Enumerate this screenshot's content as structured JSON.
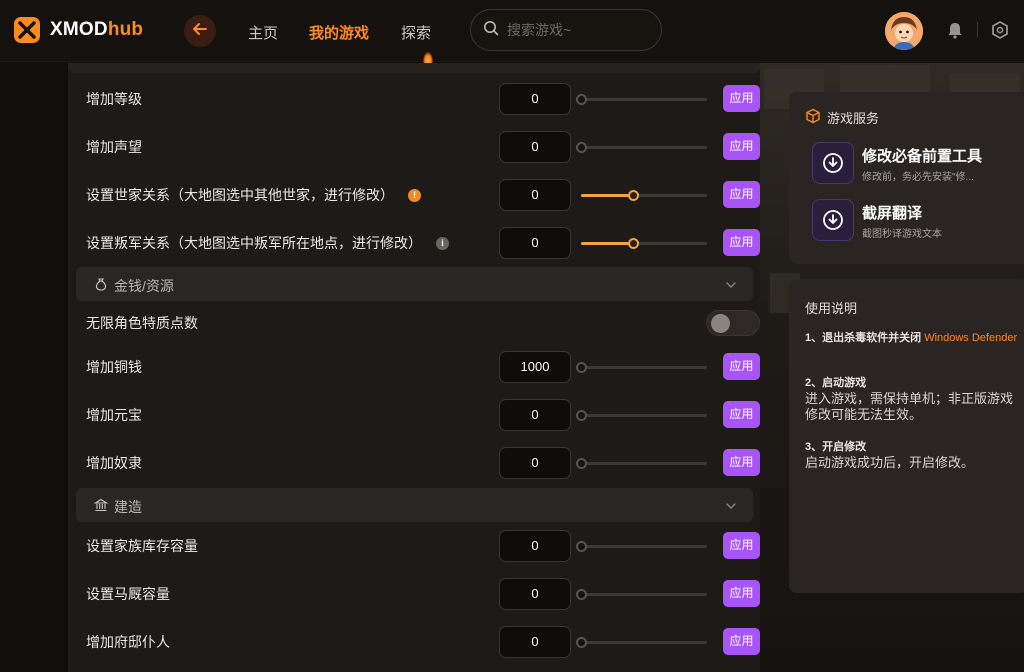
{
  "header": {
    "brand_main": "XMOD",
    "brand_hub": "hub",
    "nav": [
      "主页",
      "我的游戏",
      "探索"
    ],
    "active_nav": "我的游戏",
    "search_placeholder": "搜索游戏~"
  },
  "rows_top": [
    {
      "label": "增加等级",
      "value": "0",
      "slider": 0.0,
      "button": "应用"
    },
    {
      "label": "增加声望",
      "value": "0",
      "slider": 0.0,
      "button": "应用"
    },
    {
      "label": "设置世家关系（大地图选中其他世家，进行修改）",
      "value": "0",
      "slider": 0.5,
      "button": "应用"
    },
    {
      "label": "设置叛军关系（大地图选中叛军所在地点，进行修改）",
      "value": "0",
      "slider": 0.5,
      "button": "应用"
    }
  ],
  "sections": [
    {
      "title": "金钱/资源",
      "toggle_label": "无限角色特质点数",
      "toggle_on": false,
      "rows": [
        {
          "label": "增加铜钱",
          "value": "1000",
          "slider": 0.0,
          "button": "应用"
        },
        {
          "label": "增加元宝",
          "value": "0",
          "slider": 0.0,
          "button": "应用"
        },
        {
          "label": "增加奴隶",
          "value": "0",
          "slider": 0.0,
          "button": "应用"
        }
      ]
    },
    {
      "title": "建造",
      "rows": [
        {
          "label": "设置家族库存容量",
          "value": "0",
          "slider": 0.0,
          "button": "应用"
        },
        {
          "label": "设置马厩容量",
          "value": "0",
          "slider": 0.0,
          "button": "应用"
        },
        {
          "label": "增加府邸仆人",
          "value": "0",
          "slider": 0.0,
          "button": "应用"
        }
      ]
    }
  ],
  "service_panel": {
    "title": "游戏服务",
    "items": [
      {
        "name": "修改必备前置工具",
        "sub": "修改前，务必先安装\"修..."
      },
      {
        "name": "截屏翻译",
        "sub": "截图秒译游戏文本"
      }
    ]
  },
  "guide_panel": {
    "title": "使用说明",
    "step1_title": "1、退出杀毒软件并关闭",
    "step1_highlight": "Windows Defender",
    "step2_title": "2、启动游戏",
    "step2_body": "进入游戏，需保持单机；非正版游戏修改可能无法生效。",
    "step3_title": "3、开启修改",
    "step3_body": "启动游戏成功后，开启修改。"
  },
  "colors": {
    "accent": "#ff8a1d",
    "apply_button": "#a855f7",
    "slider_fill": "#f2a33a",
    "background": "#120e0b"
  },
  "icons": {
    "logo": "xmod-logo-icon",
    "back": "arrow-left-icon",
    "search": "search-icon",
    "notification": "bell-icon",
    "settings": "hexagon-settings-icon",
    "section_money": "money-bag-icon",
    "section_build": "building-icon",
    "service": "gift-box-icon",
    "download": "download-circle-icon"
  }
}
